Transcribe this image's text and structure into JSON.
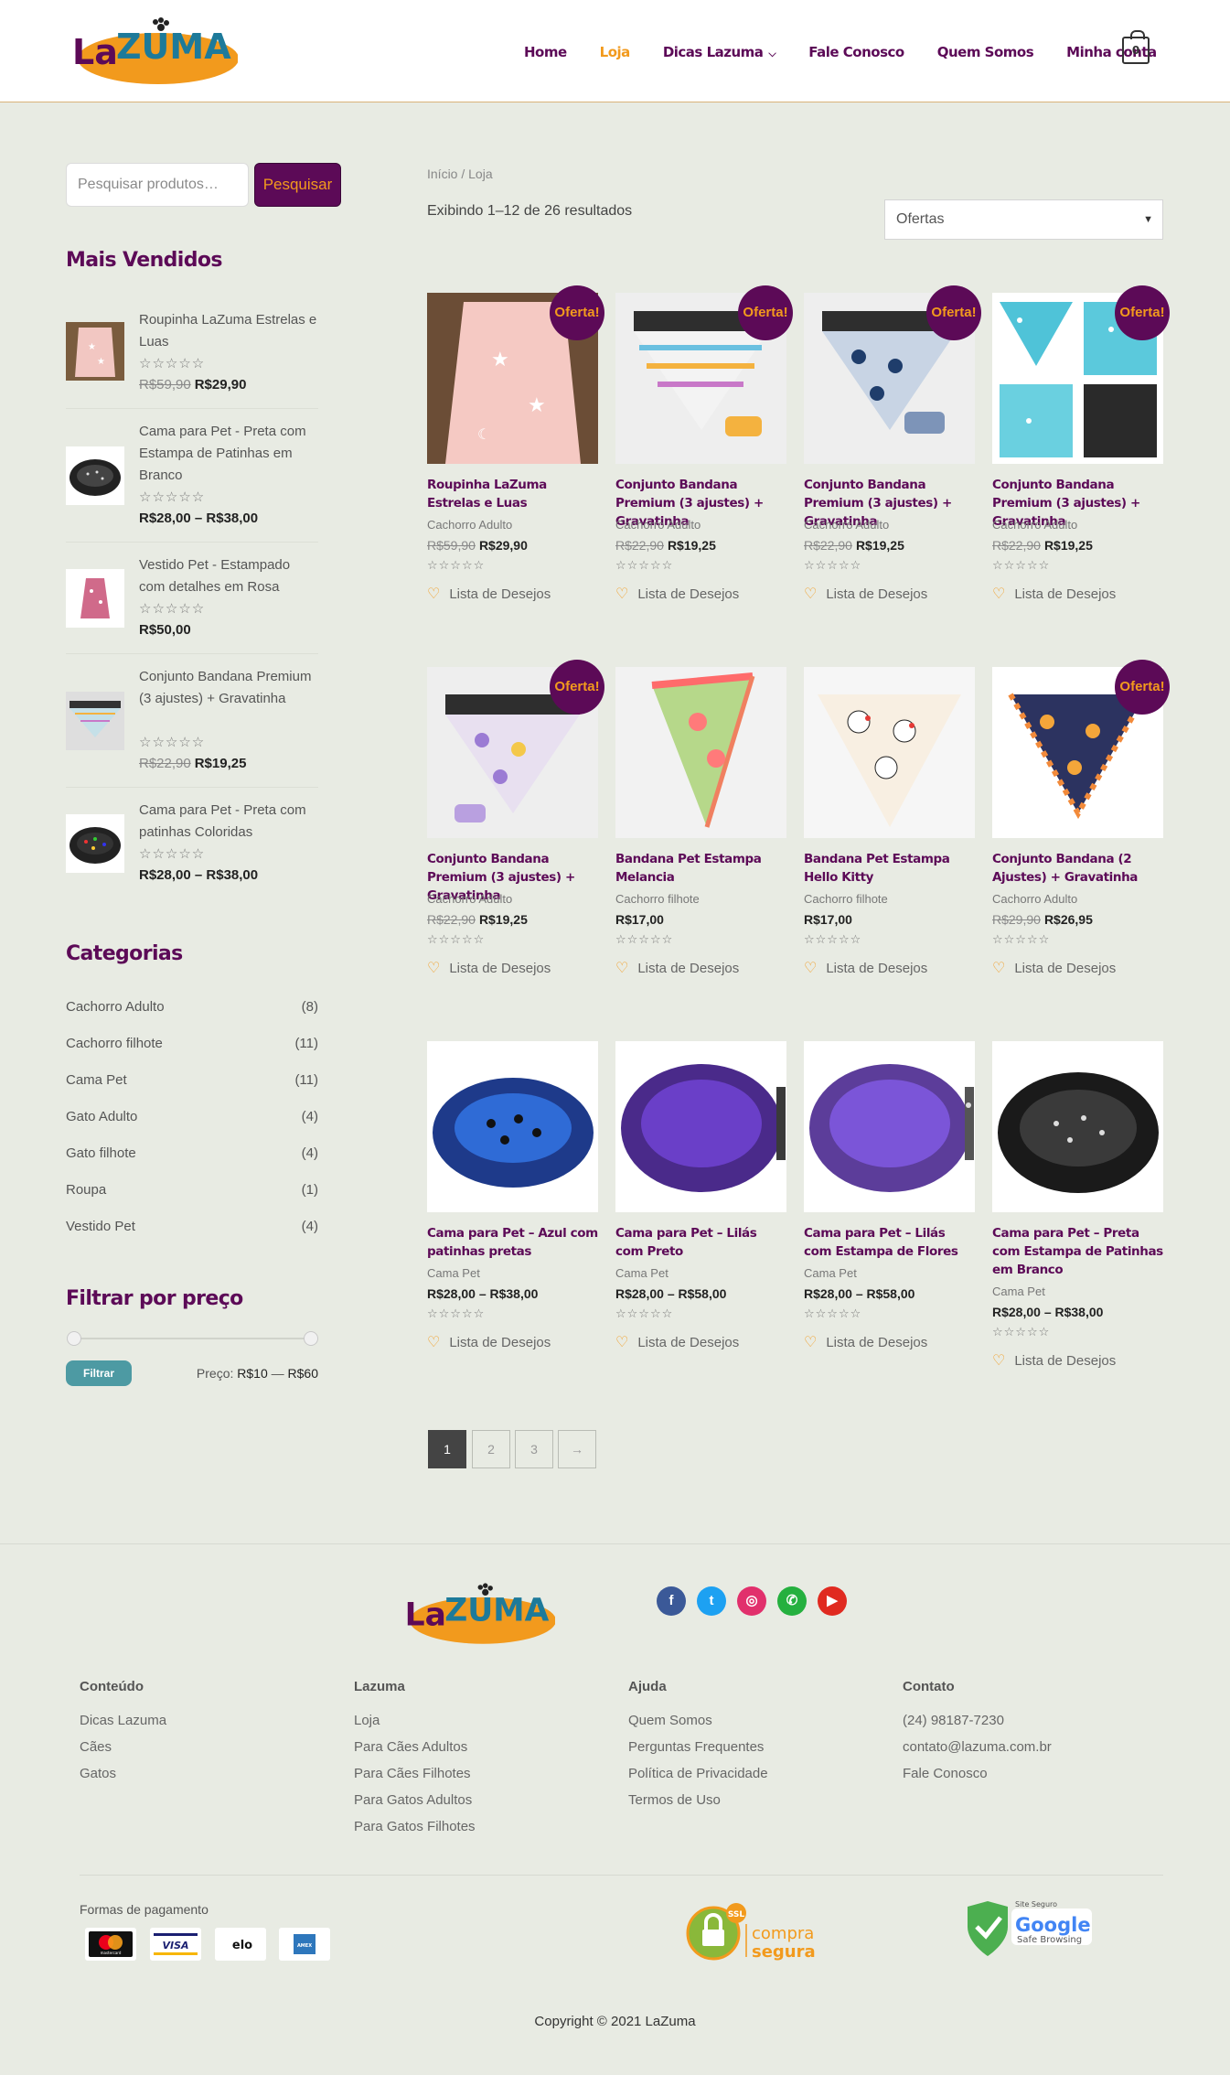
{
  "header": {
    "nav": [
      "Home",
      "Loja",
      "Dicas Lazuma",
      "Fale Conosco",
      "Quem Somos",
      "Minha conta"
    ],
    "cart_count": "0"
  },
  "sidebar": {
    "search_placeholder": "Pesquisar produtos…",
    "search_button": "Pesquisar",
    "best_title": "Mais Vendidos",
    "best": [
      {
        "name": "Roupinha LaZuma Estrelas e Luas",
        "old": "R$59,90",
        "price": "R$29,90"
      },
      {
        "name": "Cama para Pet - Preta com Estampa de Patinhas em Branco",
        "old": "",
        "price": "R$28,00 – R$38,00"
      },
      {
        "name": "Vestido Pet - Estampado com detalhes em Rosa",
        "old": "",
        "price": "R$50,00"
      },
      {
        "name": "Conjunto Bandana Premium (3 ajustes) + Gravatinha",
        "old": "R$22,90",
        "price": "R$19,25"
      },
      {
        "name": "Cama para Pet - Preta com patinhas Coloridas",
        "old": "",
        "price": "R$28,00 – R$38,00"
      }
    ],
    "cat_title": "Categorias",
    "categories": [
      {
        "name": "Cachorro Adulto",
        "count": "(8)"
      },
      {
        "name": "Cachorro filhote",
        "count": "(11)"
      },
      {
        "name": "Cama Pet",
        "count": "(11)"
      },
      {
        "name": "Gato Adulto",
        "count": "(4)"
      },
      {
        "name": "Gato filhote",
        "count": "(4)"
      },
      {
        "name": "Roupa",
        "count": "(1)"
      },
      {
        "name": "Vestido Pet",
        "count": "(4)"
      }
    ],
    "filter_title": "Filtrar por preço",
    "filter_button": "Filtrar",
    "price_label": "Preço:",
    "price_min": "R$10",
    "price_sep": "—",
    "price_max": "R$60"
  },
  "main": {
    "breadcrumb": "Início / Loja",
    "result_count": "Exibindo 1–12 de 26 resultados",
    "orderby": "Ofertas",
    "sale_label": "Oferta!",
    "wish_label": "Lista de Desejos",
    "stars": "☆☆☆☆☆",
    "products": [
      {
        "title": "Roupinha LaZuma Estrelas e Luas",
        "cat": "Cachorro Adulto",
        "old": "R$59,90",
        "price": "R$29,90",
        "sale": true
      },
      {
        "title": "Conjunto Bandana Premium (3 ajustes) + Gravatinha",
        "cat": "Cachorro Adulto",
        "old": "R$22,90",
        "price": "R$19,25",
        "sale": true
      },
      {
        "title": "Conjunto Bandana Premium (3 ajustes) + Gravatinha",
        "cat": "Cachorro Adulto",
        "old": "R$22,90",
        "price": "R$19,25",
        "sale": true
      },
      {
        "title": "Conjunto Bandana Premium (3 ajustes) + Gravatinha",
        "cat": "Cachorro Adulto",
        "old": "R$22,90",
        "price": "R$19,25",
        "sale": true
      },
      {
        "title": "Conjunto Bandana Premium (3 ajustes) + Gravatinha",
        "cat": "Cachorro Adulto",
        "old": "R$22,90",
        "price": "R$19,25",
        "sale": true
      },
      {
        "title": "Bandana Pet Estampa Melancia",
        "cat": "Cachorro filhote",
        "old": "",
        "price": "R$17,00",
        "sale": false
      },
      {
        "title": "Bandana Pet Estampa Hello Kitty",
        "cat": "Cachorro filhote",
        "old": "",
        "price": "R$17,00",
        "sale": false
      },
      {
        "title": "Conjunto Bandana (2 Ajustes) + Gravatinha",
        "cat": "Cachorro Adulto",
        "old": "R$29,90",
        "price": "R$26,95",
        "sale": true
      },
      {
        "title": "Cama para Pet – Azul com patinhas pretas",
        "cat": "Cama Pet",
        "old": "",
        "price": "R$28,00 – R$38,00",
        "sale": false
      },
      {
        "title": "Cama para Pet – Lilás com Preto",
        "cat": "Cama Pet",
        "old": "",
        "price": "R$28,00 – R$58,00",
        "sale": false
      },
      {
        "title": "Cama para Pet – Lilás com Estampa de Flores",
        "cat": "Cama Pet",
        "old": "",
        "price": "R$28,00 – R$58,00",
        "sale": false
      },
      {
        "title": "Cama para Pet – Preta com Estampa de Patinhas em Branco",
        "cat": "Cama Pet",
        "old": "",
        "price": "R$28,00 – R$38,00",
        "sale": false
      }
    ],
    "pages": [
      "1",
      "2",
      "3",
      "→"
    ]
  },
  "footer": {
    "columns": [
      {
        "title": "Conteúdo",
        "links": [
          "Dicas Lazuma",
          "Cães",
          "Gatos"
        ]
      },
      {
        "title": "Lazuma",
        "links": [
          "Loja",
          "Para Cães Adultos",
          "Para Cães Filhotes",
          "Para Gatos Adultos",
          "Para Gatos Filhotes"
        ]
      },
      {
        "title": "Ajuda",
        "links": [
          "Quem Somos",
          "Perguntas Frequentes",
          "Política de Privacidade",
          "Termos de Uso"
        ]
      },
      {
        "title": "Contato",
        "links": [
          "(24) 98187-7230",
          "contato@lazuma.com.br",
          "Fale Conosco"
        ]
      }
    ],
    "payment_label": "Formas de pagamento",
    "cards": [
      "mastercard",
      "VISA",
      "elo",
      "AMEX"
    ],
    "ssl_top": "SSL",
    "ssl_text1": "compra",
    "ssl_text2": "segura",
    "google_top": "Site Seguro",
    "google_name": "Google",
    "google_sub": "Safe Browsing",
    "copyright": "Copyright © 2021 LaZuma"
  },
  "colors": {
    "brand": "#5c0a57",
    "accent": "#f29a1d",
    "filter": "#4d9aa3",
    "background": "#e8ebe3"
  }
}
